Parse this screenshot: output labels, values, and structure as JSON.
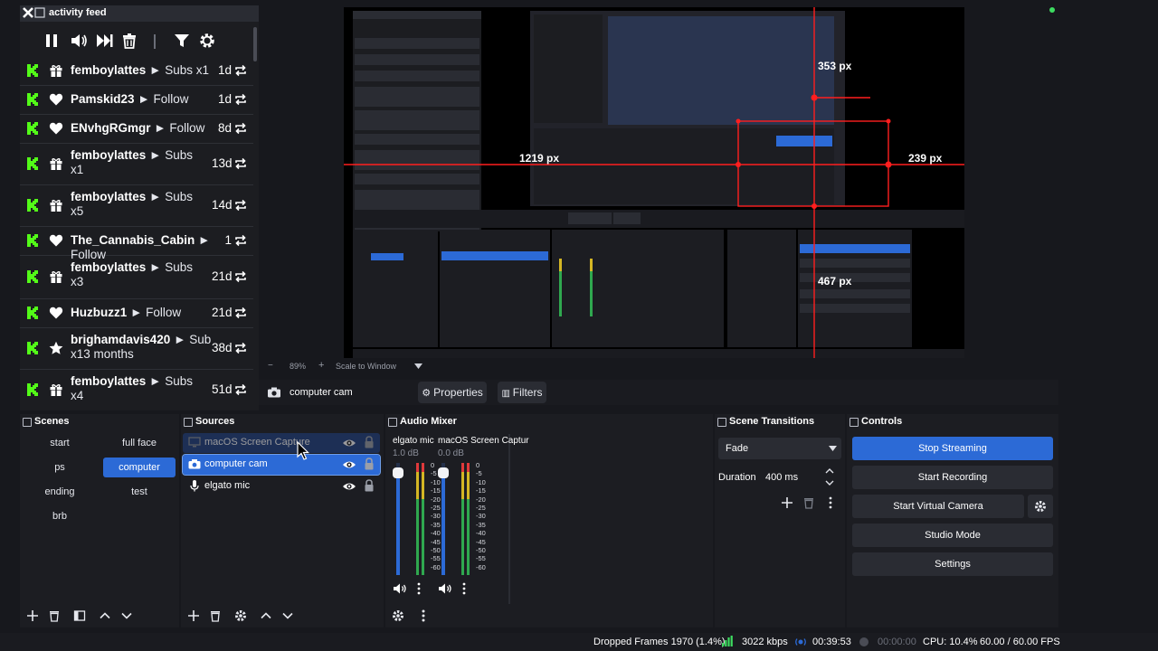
{
  "feed": {
    "title": "activity feed",
    "items": [
      {
        "user": "femboylattes",
        "sep": "►",
        "event": "Subs x1",
        "age": "1d",
        "icon": "gift-icon"
      },
      {
        "user": "Pamskid23",
        "sep": "►",
        "event": "Follow",
        "age": "1d",
        "icon": "heart-icon"
      },
      {
        "user": "ENvhgRGmgr",
        "sep": "►",
        "event": "Follow",
        "age": "8d",
        "icon": "heart-icon"
      },
      {
        "user": "femboylattes",
        "sep": "►",
        "event": "Subs",
        "event2": "x1",
        "age": "13d",
        "icon": "gift-icon"
      },
      {
        "user": "femboylattes",
        "sep": "►",
        "event": "Subs",
        "event2": "x5",
        "age": "14d",
        "icon": "gift-icon"
      },
      {
        "user": "The_Cannabis_Cabin",
        "sep": "►",
        "event": "Follow",
        "age": "1",
        "icon": "heart-icon"
      },
      {
        "user": "femboylattes",
        "sep": "►",
        "event": "Subs",
        "event2": "x3",
        "age": "21d",
        "icon": "gift-icon"
      },
      {
        "user": "Huzbuzz1",
        "sep": "►",
        "event": "Follow",
        "age": "21d",
        "icon": "heart-icon"
      },
      {
        "user": "brighamdavis420",
        "sep": "►",
        "event": "Sub",
        "event2": "x13 months",
        "age": "38d",
        "icon": "star-icon"
      },
      {
        "user": "femboylattes",
        "sep": "►",
        "event": "Subs",
        "event2": "x4",
        "age": "51d",
        "icon": "gift-icon"
      }
    ]
  },
  "preview": {
    "measure_labels": [
      "353 px",
      "1219 px",
      "239 px",
      "467 px"
    ],
    "zoom": "89%",
    "zoom_plus": "+",
    "zoom_minus": "−",
    "scale_mode": "Scale to Window"
  },
  "source_toolbar": {
    "source_name": "computer cam",
    "properties": "Properties",
    "filters": "Filters"
  },
  "scenes": {
    "title": "Scenes",
    "items": [
      "start",
      "full face",
      "ps",
      "computer",
      "ending",
      "test",
      "brb"
    ],
    "selected": "computer"
  },
  "sources": {
    "title": "Sources",
    "items": [
      {
        "name": "macOS Screen Capture",
        "icon": "monitor-icon",
        "dragging": true
      },
      {
        "name": "computer cam",
        "icon": "camera-icon",
        "selected": true
      },
      {
        "name": "elgato mic",
        "icon": "microphone-icon"
      }
    ]
  },
  "mixer": {
    "title": "Audio Mixer",
    "channels": [
      {
        "name": "elgato mic",
        "db": "1.0 dB",
        "volume_fraction": 0.93
      },
      {
        "name": "macOS Screen Captur",
        "db": "0.0 dB",
        "volume_fraction": 0.93
      }
    ],
    "scale": [
      "0",
      "-5",
      "-10",
      "-15",
      "-20",
      "-25",
      "-30",
      "-35",
      "-40",
      "-45",
      "-50",
      "-55",
      "-60"
    ]
  },
  "transitions": {
    "title": "Scene Transitions",
    "selected": "Fade",
    "duration_label": "Duration",
    "duration_value": "400 ms"
  },
  "controls": {
    "title": "Controls",
    "stop_streaming": "Stop Streaming",
    "start_recording": "Start Recording",
    "start_virtual_camera": "Start Virtual Camera",
    "studio_mode": "Studio Mode",
    "settings": "Settings"
  },
  "status": {
    "dropped_frames": "Dropped Frames 1970 (1.4%)",
    "bitrate": "3022 kbps",
    "stream_time": "00:39:53",
    "rec_time": "00:00:00",
    "cpu": "CPU: 10.4%",
    "fps": "60.00 / 60.00 FPS"
  },
  "colors": {
    "accent": "#2c6ad6",
    "kick_green": "#53fc18",
    "guide_red": "#ff1e1e",
    "meter_green": "#2fa84f",
    "meter_yellow": "#d4b624",
    "meter_red": "#e0393b"
  }
}
